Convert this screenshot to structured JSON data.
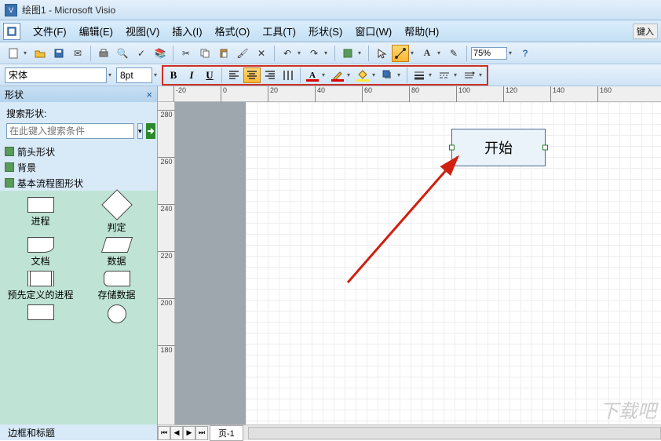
{
  "titlebar": {
    "title": "绘图1 - Microsoft Visio"
  },
  "menubar": {
    "items": [
      "文件(F)",
      "编辑(E)",
      "视图(V)",
      "插入(I)",
      "格式(O)",
      "工具(T)",
      "形状(S)",
      "窗口(W)",
      "帮助(H)"
    ],
    "tail": "键入"
  },
  "toolbar": {
    "zoom": "75%"
  },
  "toolbar2": {
    "fontname": "宋体",
    "fontsize": "8pt"
  },
  "sidebar": {
    "title": "形状",
    "search_label": "搜索形状:",
    "search_placeholder": "在此键入搜索条件",
    "cats": [
      "箭头形状",
      "背景",
      "基本流程图形状"
    ],
    "shapes": [
      "进程",
      "判定",
      "文档",
      "数据",
      "预先定义的进程",
      "存储数据"
    ],
    "footer": "边框和标题"
  },
  "canvas": {
    "hruler_ticks": [
      "-20",
      "0",
      "20",
      "40",
      "60",
      "80",
      "100",
      "120",
      "140",
      "160"
    ],
    "vruler_ticks": [
      "280",
      "260",
      "240",
      "220",
      "200",
      "180"
    ],
    "shape_text": "开始",
    "page_tab": "页-1"
  },
  "watermark": "下载吧"
}
